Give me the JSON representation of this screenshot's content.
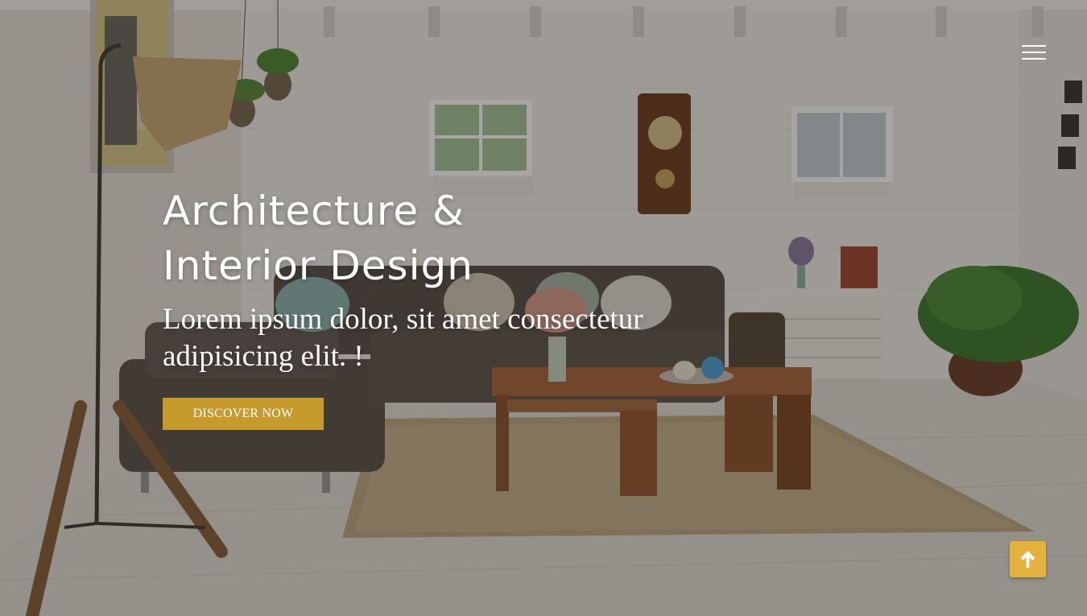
{
  "hero": {
    "title_line1": "Architecture &",
    "title_line2": "Interior Design",
    "subtitle_line1": "Lorem ipsum dolor, sit amet consectetur",
    "subtitle_line2": "adipisicing elit. !",
    "cta_label": "DISCOVER NOW"
  },
  "nav": {
    "menu_icon": "hamburger-menu-icon"
  },
  "scroll_top": {
    "icon": "arrow-up-icon"
  },
  "colors": {
    "accent": "#c79a2e",
    "scroll_top_bg": "#e3b13c",
    "text": "#ffffff"
  }
}
